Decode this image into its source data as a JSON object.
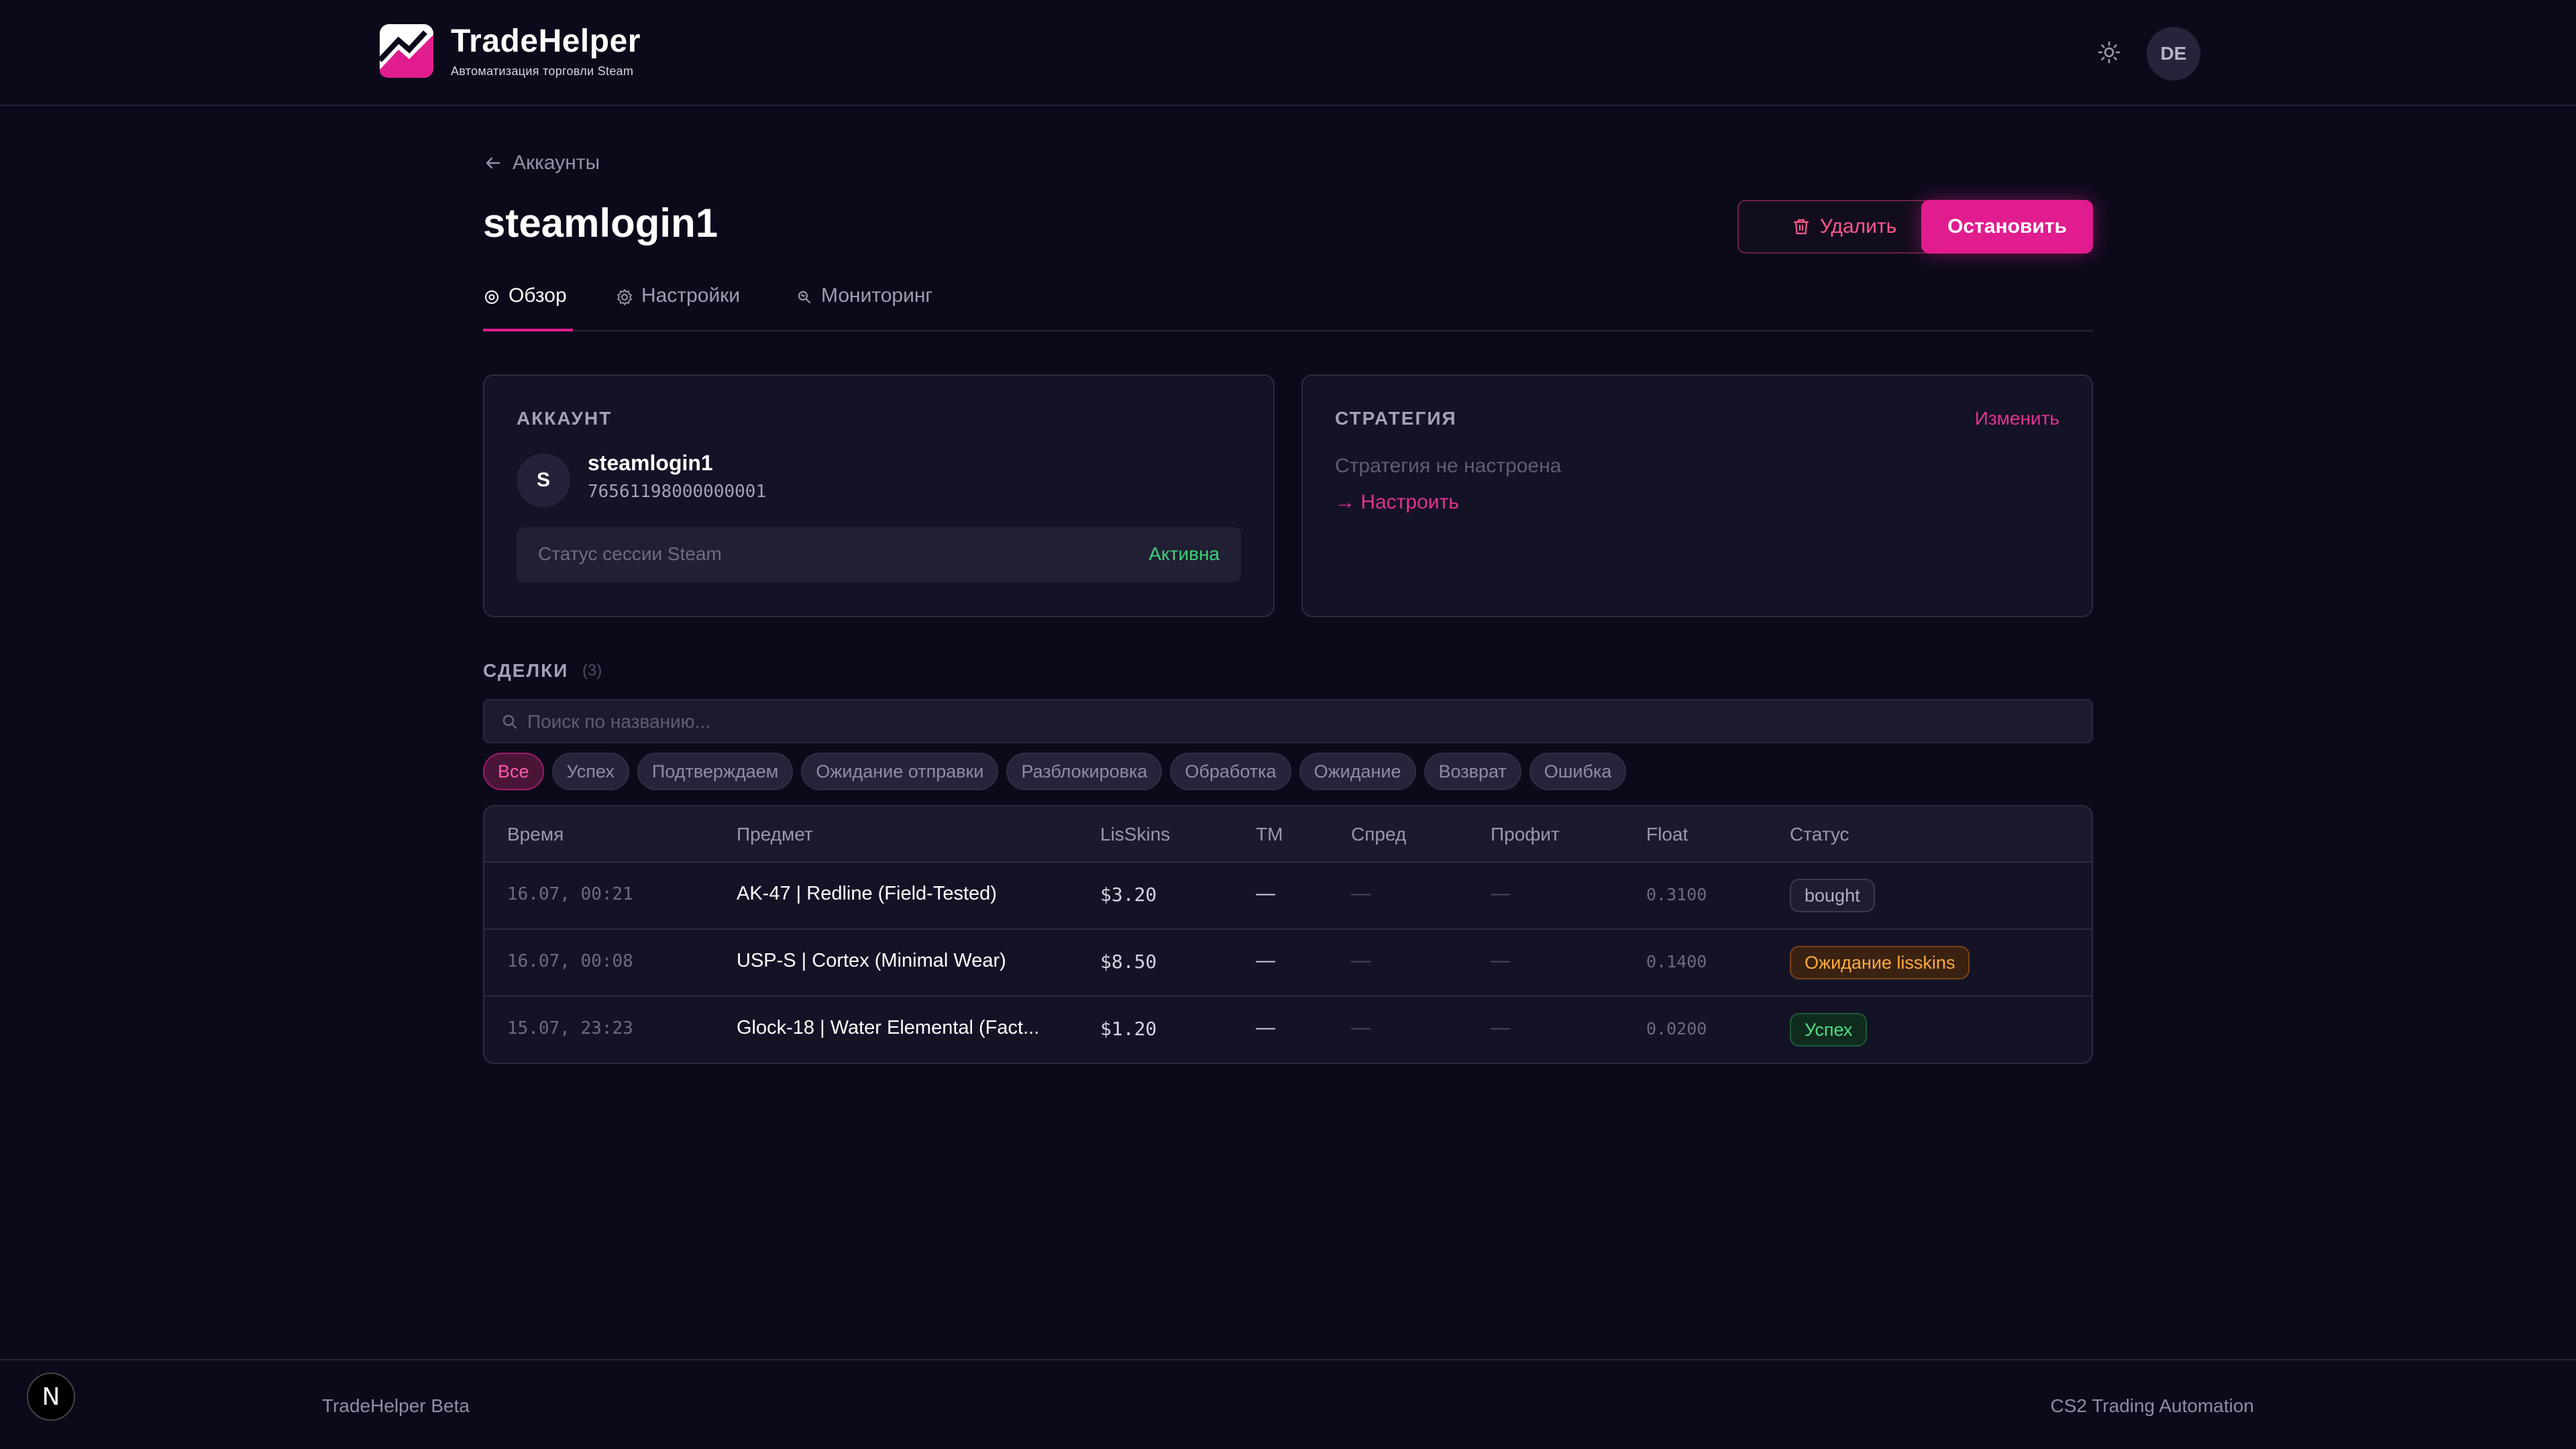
{
  "header": {
    "brand_name": "TradeHelper",
    "brand_subtitle": "Автоматизация торговли Steam",
    "avatar_initials": "DE",
    "theme_icon": "sun-icon"
  },
  "breadcrumb": {
    "label": "Аккаунты"
  },
  "page": {
    "title": "steamlogin1",
    "delete_label": "Удалить",
    "stop_label": "Остановить"
  },
  "tabs": [
    {
      "label": "Обзор",
      "icon": "overview-icon",
      "active": true
    },
    {
      "label": "Настройки",
      "icon": "gear-icon",
      "active": false
    },
    {
      "label": "Мониторинг",
      "icon": "monitor-icon",
      "active": false
    }
  ],
  "account_card": {
    "title": "АККАУНТ",
    "avatar_letter": "S",
    "login": "steamlogin1",
    "steam_id": "76561198000000001",
    "session_label": "Статус сессии Steam",
    "session_value": "Активна"
  },
  "strategy_card": {
    "title": "СТРАТЕГИЯ",
    "change_label": "Изменить",
    "empty_text": "Стратегия не настроена",
    "setup_link": "→ Настроить"
  },
  "deals": {
    "title": "СДЕЛКИ",
    "count": "(3)",
    "search_placeholder": "Поиск по названию...",
    "filters": [
      "Все",
      "Успех",
      "Подтверждаем",
      "Ожидание отправки",
      "Разблокировка",
      "Обработка",
      "Ожидание",
      "Возврат",
      "Ошибка"
    ],
    "active_filter": "Все",
    "columns": [
      "Время",
      "Предмет",
      "LisSkins",
      "TM",
      "Спред",
      "Профит",
      "Float",
      "Статус"
    ],
    "rows": [
      {
        "time": "16.07, 00:21",
        "item": "AK-47 | Redline (Field-Tested)",
        "lisskins": "$3.20",
        "tm": "—",
        "spread": "—",
        "profit": "—",
        "float": "0.3100",
        "status": "bought"
      },
      {
        "time": "16.07, 00:08",
        "item": "USP-S | Cortex (Minimal Wear)",
        "lisskins": "$8.50",
        "tm": "—",
        "spread": "—",
        "profit": "—",
        "float": "0.1400",
        "status": "Ожидание lisskins"
      },
      {
        "time": "15.07, 23:23",
        "item": "Glock-18 | Water Elemental (Fact...",
        "lisskins": "$1.20",
        "tm": "—",
        "spread": "—",
        "profit": "—",
        "float": "0.0200",
        "status": "Успех"
      }
    ]
  },
  "footer": {
    "left": "TradeHelper Beta",
    "right": "CS2 Trading Automation",
    "dev_badge": "N"
  },
  "colors": {
    "background": "#0b0a1a",
    "accent": "#e01c8e",
    "success": "#3fd07a",
    "warning": "#ffab3f"
  }
}
